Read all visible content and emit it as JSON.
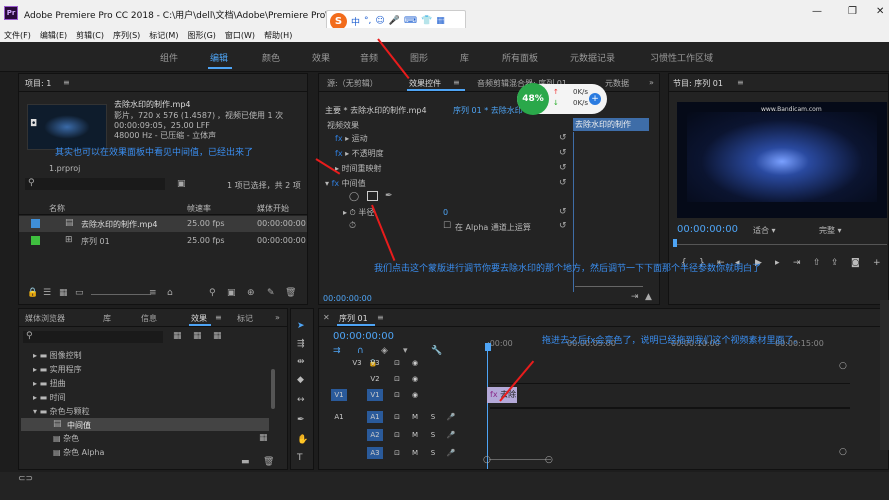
{
  "window": {
    "title": "Adobe Premiere Pro CC 2018 - C:\\用户\\dell\\文档\\Adobe\\Premiere Pro\\12.0",
    "app_icon": "Pr",
    "minimize": "—",
    "maximize": "❐",
    "close": "✕"
  },
  "ime": {
    "logo": "S",
    "mode": "中",
    "punct": "°,",
    "emoji": "☺",
    "mic": "🎤",
    "keyboard": "⌨",
    "skin": "👕",
    "tools": "▦"
  },
  "menu": [
    "文件(F)",
    "编辑(E)",
    "剪辑(C)",
    "序列(S)",
    "标记(M)",
    "图形(G)",
    "窗口(W)",
    "帮助(H)"
  ],
  "workspaces": [
    "组件",
    "编辑",
    "颜色",
    "效果",
    "音频",
    "图形",
    "库",
    "所有面板",
    "元数据记录",
    "习惯性工作区域"
  ],
  "project": {
    "tab": "项目: 1",
    "menu": "≡",
    "clip_name": "去除水印的制作.mp4",
    "clip_info1": "影片，720 x 576 (1.4587)",
    "clip_info2": "00:00:09:05，25.00 LFF",
    "clip_info3": "48000 Hz - 已压缩 - 立体声",
    "used": "，视频已使用 1 次",
    "file": "1.prproj",
    "selection": "1 项已选择，共 2 项",
    "col_name": "名称",
    "col_fps": "帧速率",
    "col_start": "媒体开始",
    "items": [
      {
        "name": "去除水印的制作.mp4",
        "fps": "25.00 fps",
        "start": "00:00:00:00"
      },
      {
        "name": "序列 01",
        "fps": "25.00 fps",
        "start": "00:00:00:00"
      }
    ]
  },
  "effect_controls": {
    "tabs": [
      "源:（无剪辑）",
      "效果控件",
      "≡",
      "音频剪辑混合器: 序列 01",
      "元数据"
    ],
    "master": "主要 * 去除水印的制作.mp4",
    "seq": "序列 01 * 去除水印",
    "timecode": "00:00:00:00",
    "section": "视频效果",
    "effects": [
      "运动",
      "不透明度",
      "时间重映射",
      "中间值"
    ],
    "radius_label": "半径",
    "radius_value": "0",
    "alpha_label": "在 Alpha 通道上运算",
    "clip_label": "去除水印的制作"
  },
  "net": {
    "percent": "48%",
    "up": "0K/s",
    "down": "0K/s"
  },
  "program": {
    "tab": "节目: 序列 01",
    "menu": "≡",
    "timecode": "00:00:00:00",
    "fit": "适合",
    "quality": "完整",
    "watermark": "www.Bandicam.com"
  },
  "effects_panel": {
    "tabs": [
      "媒体浏览器",
      "库",
      "信息",
      "效果",
      "≡",
      "标记"
    ],
    "search": "",
    "tree": [
      "图像控制",
      "实用程序",
      "扭曲",
      "时间",
      "杂色与颗粒",
      "中间值",
      "杂色",
      "杂色 Alpha"
    ]
  },
  "timeline": {
    "tab": "序列 01",
    "menu": "≡",
    "timecode": "00:00:00:00",
    "ruler": [
      ":00:00",
      "00:00:05:00",
      "00:00:10:00",
      "00:00:15:00"
    ],
    "tracks": [
      "V3",
      "V2",
      "V1",
      "A1",
      "A2",
      "A3"
    ],
    "clip": "去除"
  },
  "annotations": {
    "a1": "其实也可以在效果面板中看见中间值，已经出来了",
    "a2": "我们点击这个蒙版进行调节你要去除水印的那个地方，然后调节一下下面那个半径参数你就明白了",
    "a3": "拖进去之后fx会变色了，说明已经拖到我们这个视频素材里面了。"
  },
  "colors": {
    "accent": "#4ea4f5",
    "annotation": "#3a8ef0",
    "arrow": "#e81c1c"
  }
}
